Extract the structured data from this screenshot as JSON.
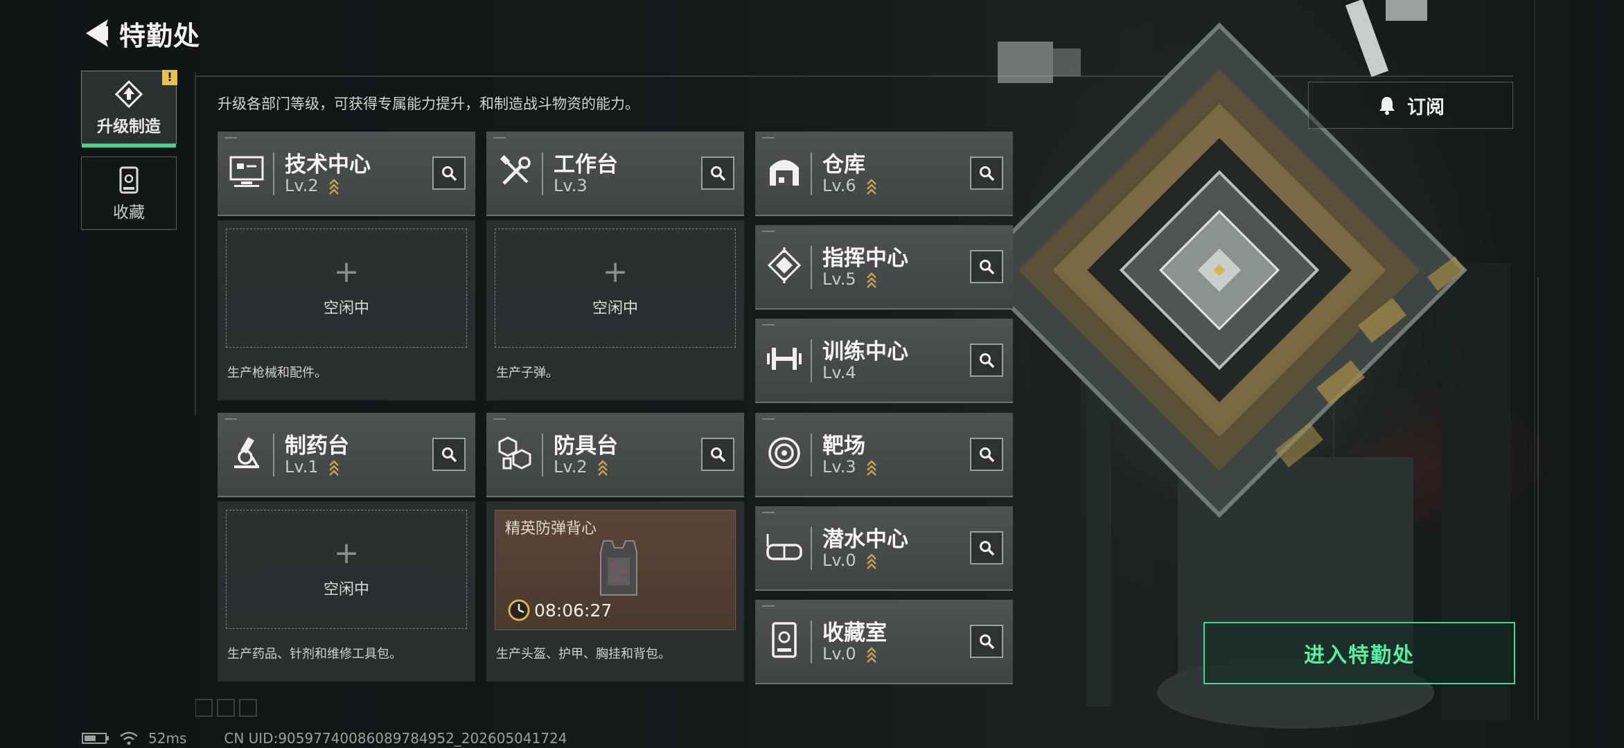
{
  "header": {
    "title": "特勤处"
  },
  "sidebar": {
    "tabs": [
      {
        "label": "升级制造",
        "badge": "!"
      },
      {
        "label": "收藏"
      }
    ]
  },
  "description": "升级各部门等级，可获得专属能力提升，和制造战斗物资的能力。",
  "subscribe": {
    "label": "订阅"
  },
  "facilities": {
    "tech": {
      "name": "技术中心",
      "level": "Lv.2",
      "upgradable": true
    },
    "workbench": {
      "name": "工作台",
      "level": "Lv.3",
      "upgradable": false
    },
    "pharmacy": {
      "name": "制药台",
      "level": "Lv.1",
      "upgradable": true
    },
    "armor": {
      "name": "防具台",
      "level": "Lv.2",
      "upgradable": true
    },
    "warehouse": {
      "name": "仓库",
      "level": "Lv.6",
      "upgradable": true
    },
    "command": {
      "name": "指挥中心",
      "level": "Lv.5",
      "upgradable": true
    },
    "training": {
      "name": "训练中心",
      "level": "Lv.4",
      "upgradable": false
    },
    "range": {
      "name": "靶场",
      "level": "Lv.3",
      "upgradable": true
    },
    "diving": {
      "name": "潜水中心",
      "level": "Lv.0",
      "upgradable": true
    },
    "collection": {
      "name": "收藏室",
      "level": "Lv.0",
      "upgradable": true
    }
  },
  "production": {
    "tech": {
      "idle_label": "空闲中",
      "desc": "生产枪械和配件。"
    },
    "workbench": {
      "idle_label": "空闲中",
      "desc": "生产子弹。"
    },
    "pharmacy": {
      "idle_label": "空闲中",
      "desc": "生产药品、针剂和维修工具包。"
    },
    "armor": {
      "item_name": "精英防弹背心",
      "time_left": "08:06:27",
      "desc": "生产头盔、护甲、胸挂和背包。"
    }
  },
  "enter_button": {
    "label": "进入特勤处"
  },
  "status_bar": {
    "ping": "52ms",
    "uid": "CN UID:9059774008608978495​2_202605041724"
  },
  "colors": {
    "accent_green": "#3ddc8a",
    "upgrade_gold": "#c9a44a",
    "card_bg": "#4a4e4e"
  }
}
